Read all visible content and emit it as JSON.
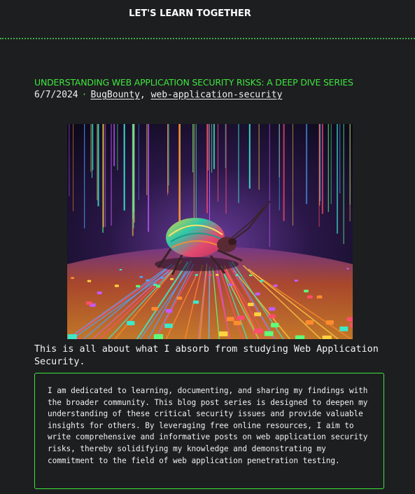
{
  "header": {
    "site_title": "LET'S LEARN TOGETHER"
  },
  "post": {
    "title": "UNDERSTANDING WEB APPLICATION SECURITY RISKS: A DEEP DIVE SERIES",
    "date": "6/7/2024",
    "separator": "·",
    "tags": [
      "BugBounty",
      "web-application-security"
    ],
    "tag_comma": ",",
    "intro": "This is all about what I absorb from studying Web Application Security.",
    "quote": "I am dedicated to learning, documenting, and sharing my findings with the broader community. This blog post series is designed to deepen my understanding of these critical security issues and provide valuable insights for others. By leveraging free online resources, I aim to write comprehensive and informative posts on web application security risks, thereby solidifying my knowledge and demonstrating my commitment to the field of web application penetration testing."
  },
  "colors": {
    "background": "#1d1e20",
    "accent_green": "#3ee73e",
    "divider": "#3fae4c",
    "text": "#f0f0f0"
  },
  "icons": {
    "hero_image": "circuit-board-beetle-image"
  }
}
